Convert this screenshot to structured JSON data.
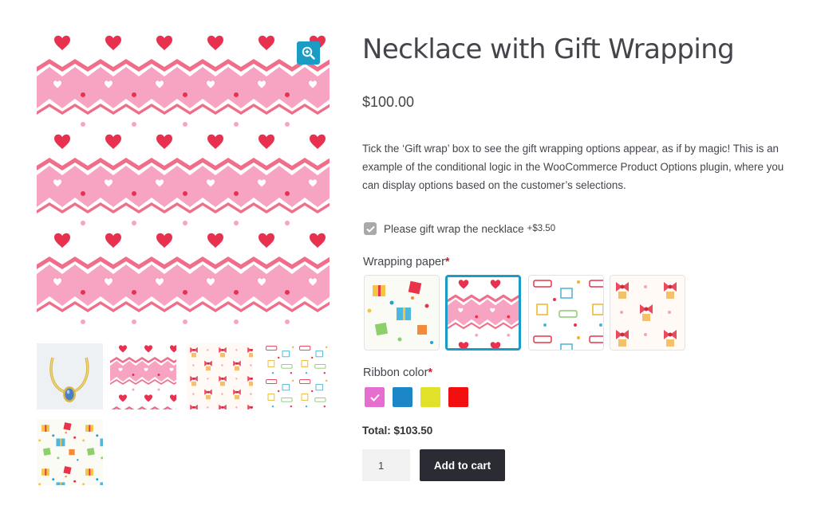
{
  "product": {
    "title": "Necklace with Gift Wrapping",
    "price": "$100.00",
    "description": "Tick the ‘Gift wrap’ box to see the gift wrapping options appear, as if by magic! This is an example of the conditional logic in the WooCommerce Product Options plugin, where you can display options based on the customer’s selections."
  },
  "gallery": {
    "main_image": "hearts-chevron-wrapping-paper",
    "zoom_icon": "magnify-plus-icon",
    "thumbnails": [
      "necklace",
      "hearts-chevron",
      "gift-bows",
      "birthday-gifts",
      "colorful-gifts"
    ]
  },
  "gift_wrap": {
    "label": "Please gift wrap the necklace",
    "price": "+$3.50",
    "checked": true
  },
  "wrapping_paper": {
    "label": "Wrapping paper",
    "required_mark": "*",
    "options": [
      "colorful-gifts",
      "hearts-chevron",
      "birthday-gifts",
      "gift-bows"
    ],
    "selected": "hearts-chevron"
  },
  "ribbon_color": {
    "label": "Ribbon color",
    "required_mark": "*",
    "options": [
      "#e46fcf",
      "#1b87c6",
      "#e2e12a",
      "#f20f0f"
    ],
    "selected": "#e46fcf"
  },
  "total": {
    "label": "Total:",
    "value": "$103.50"
  },
  "cart": {
    "quantity": "1",
    "button_label": "Add to cart"
  },
  "colors": {
    "accent": "#1b9cc5",
    "button": "#2b2b33",
    "required": "#c3232d"
  }
}
